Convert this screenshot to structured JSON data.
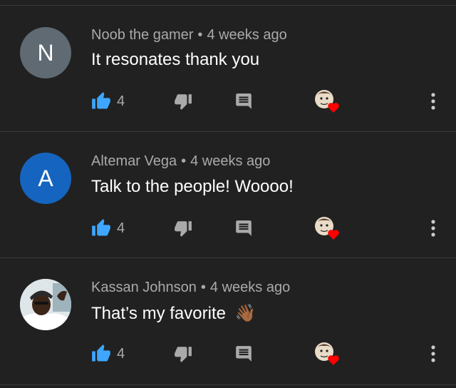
{
  "comments": [
    {
      "avatar_letter": "N",
      "avatar_color": "#5f6a72",
      "author": "Noob the gamer",
      "separator": "•",
      "time": "4 weeks ago",
      "text": "It resonates thank you",
      "emoji": "",
      "likes": "4"
    },
    {
      "avatar_letter": "A",
      "avatar_color": "#1565c0",
      "author": "Altemar Vega",
      "separator": "•",
      "time": "4 weeks ago",
      "text": "Talk to the people! Woooo!",
      "emoji": "",
      "likes": "4"
    },
    {
      "avatar_letter": "",
      "avatar_color": "#cfd8dc",
      "author": "Kassan Johnson",
      "separator": "•",
      "time": "4 weeks ago",
      "text": "That’s my favorite",
      "emoji": "👋🏾",
      "likes": "4"
    }
  ],
  "colors": {
    "background": "#212121",
    "like_blue": "#3ea6ff",
    "heart_red": "#ff0000",
    "icon_gray": "#aaaaaa"
  }
}
